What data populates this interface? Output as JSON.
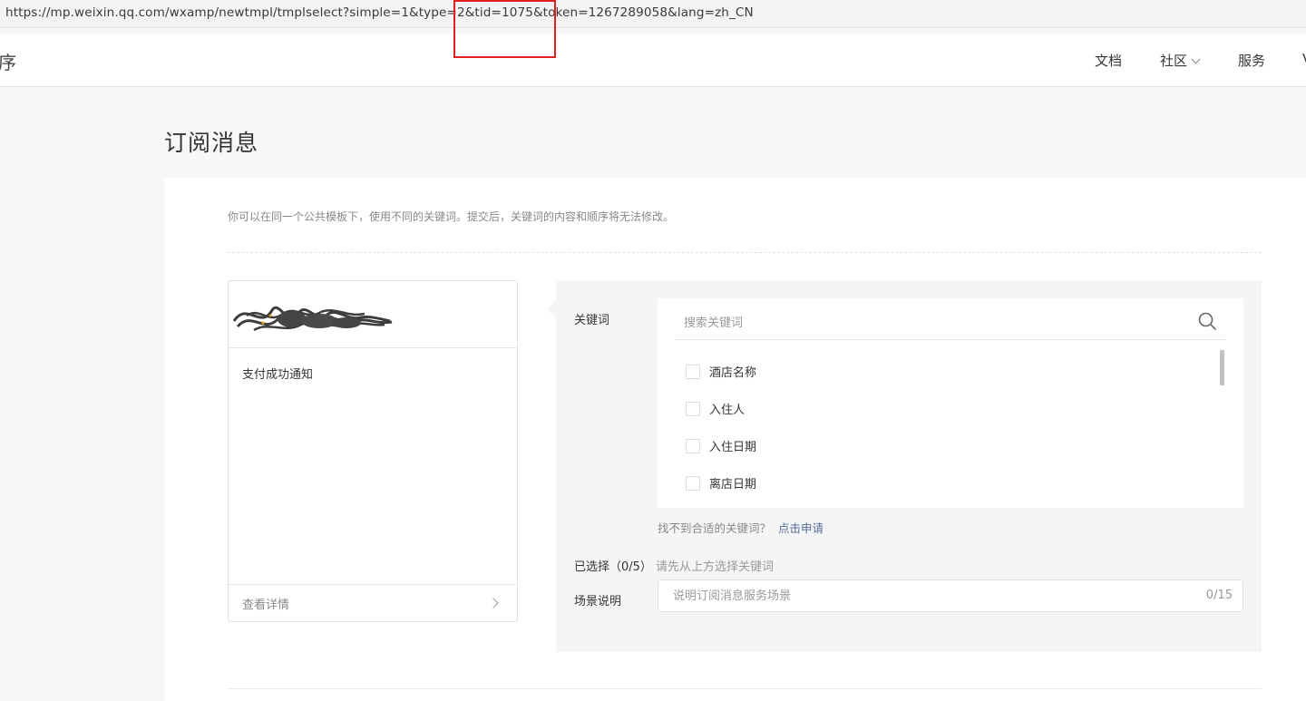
{
  "browser": {
    "url": "https://mp.weixin.qq.com/wxamp/newtmpl/tmplselect?simple=1&type=2&tid=1075&token=1267289058&lang=zh_CN"
  },
  "topnav": {
    "logo_tail": "序",
    "items": [
      {
        "label": "文档"
      },
      {
        "label": "社区"
      },
      {
        "label": "服务"
      },
      {
        "label": "V"
      }
    ]
  },
  "page": {
    "title": "订阅消息",
    "hint": "你可以在同一个公共模板下，使用不同的关键词。提交后，关键词的内容和顺序将无法修改。"
  },
  "template_card": {
    "title": "支付成功通知",
    "detail_label": "查看详情"
  },
  "form": {
    "keyword_label": "关键词",
    "search_placeholder": "搜索关键词",
    "keywords": [
      {
        "label": "酒店名称",
        "checked": false
      },
      {
        "label": "入住人",
        "checked": false
      },
      {
        "label": "入住日期",
        "checked": false
      },
      {
        "label": "离店日期",
        "checked": false
      }
    ],
    "cannot_find": "找不到合适的关键词？",
    "apply_link": "点击申请",
    "selected_label": "已选择（0/5）",
    "selected_hint": "请先从上方选择关键词",
    "scene_label": "场景说明",
    "scene_placeholder": "说明订阅消息服务场景",
    "scene_count": "0/15"
  },
  "colors": {
    "annotation_box": "#e02020",
    "link": "#576b95",
    "form_bg": "#f4f5f7"
  }
}
